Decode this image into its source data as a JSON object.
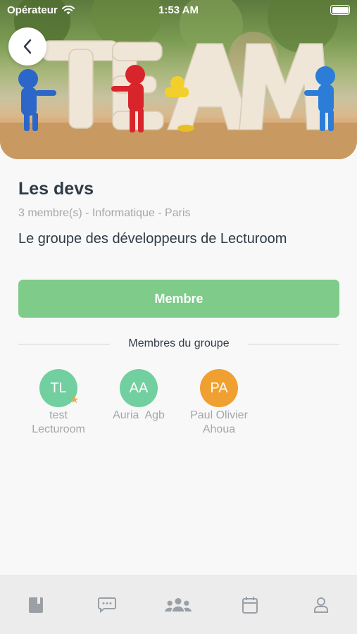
{
  "status_bar": {
    "carrier": "Opérateur",
    "time": "1:53 AM"
  },
  "hero": {
    "word": "TEAM"
  },
  "group": {
    "name": "Les devs",
    "meta": "3 membre(s) - Informatique - Paris",
    "description": "Le groupe des développeurs de Lecturoom"
  },
  "member_button": {
    "label": "Membre"
  },
  "members_section": {
    "title": "Membres du groupe"
  },
  "members": [
    {
      "initials": "TL",
      "name_line1": "test",
      "name_line2": "Lecturoom",
      "color": "#72cf9f",
      "admin": true
    },
    {
      "initials": "AA",
      "name_line1": "Auria  Agb",
      "name_line2": "",
      "color": "#72cf9f",
      "admin": false
    },
    {
      "initials": "PA",
      "name_line1": "Paul Olivier",
      "name_line2": "Ahoua",
      "color": "#f0a030",
      "admin": false
    }
  ],
  "tabs": [
    {
      "icon": "book-icon",
      "active": false
    },
    {
      "icon": "chat-icon",
      "active": false
    },
    {
      "icon": "groups-icon",
      "active": true
    },
    {
      "icon": "calendar-icon",
      "active": false
    },
    {
      "icon": "profile-icon",
      "active": false
    }
  ],
  "colors": {
    "accent_green": "#7fcb89",
    "text_dark": "#2f3b46",
    "text_muted": "#a3a7ab"
  }
}
